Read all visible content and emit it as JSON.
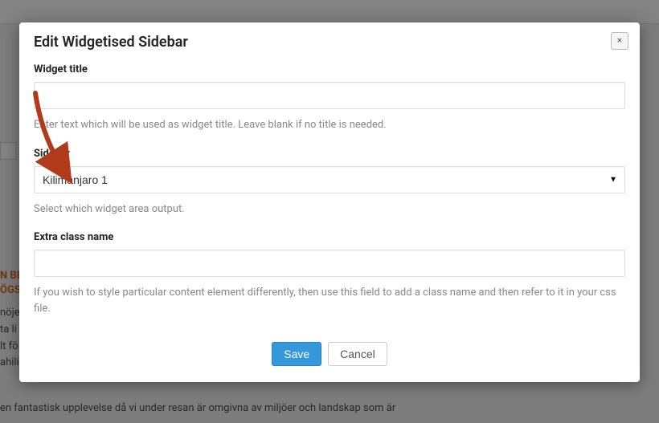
{
  "modal": {
    "title": "Edit Widgetised Sidebar",
    "close_symbol": "×"
  },
  "fields": {
    "widget_title": {
      "label": "Widget title",
      "value": "",
      "desc": "Enter text which will be used as widget title. Leave blank if no title is needed."
    },
    "sidebar": {
      "label": "Sidebar",
      "selected": "Kilimanjaro 1",
      "desc": "Select which widget area output."
    },
    "extra_class": {
      "label": "Extra class name",
      "value": "",
      "desc": "If you wish to style particular content element differently, then use this field to add a class name and then refer to it in your css file."
    }
  },
  "footer": {
    "save": "Save",
    "cancel": "Cancel"
  },
  "background": {
    "heading_line1": "N BE",
    "heading_line2": "ÖGST",
    "body_line1": "nöje",
    "body_line2": "ta li",
    "body_line3": "lt fö",
    "body_line4": "ahili",
    "body_last": "en fantastisk upplevelse då vi under resan är omgivna av miljöer och landskap som är"
  }
}
